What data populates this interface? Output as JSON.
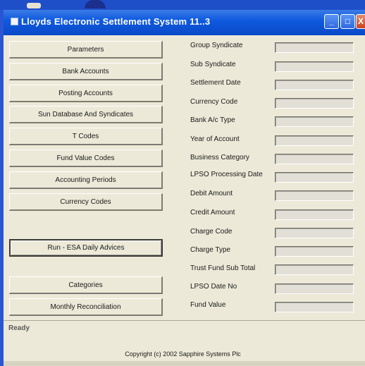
{
  "window": {
    "title": "Lloyds Electronic Settlement System 11..3",
    "controls": {
      "minimize": "_",
      "maximize": "□",
      "close": "X"
    }
  },
  "buttons": [
    "Parameters",
    "Bank Accounts",
    "Posting Accounts",
    "Sun Database And Syndicates",
    "T Codes",
    "Fund Value Codes",
    "Accounting Periods",
    "Currency Codes",
    "Run - ESA Daily Advices",
    "Categories",
    "Monthly Reconciliation"
  ],
  "fields": [
    {
      "label": "Group Syndicate",
      "value": ""
    },
    {
      "label": "Sub Syndicate",
      "value": ""
    },
    {
      "label": "Settlement Date",
      "value": ""
    },
    {
      "label": "Currency Code",
      "value": ""
    },
    {
      "label": "Bank A/c Type",
      "value": ""
    },
    {
      "label": "Year of Account",
      "value": ""
    },
    {
      "label": "Business Category",
      "value": ""
    },
    {
      "label": "LPSO Processing Date",
      "value": ""
    },
    {
      "label": "Debit Amount",
      "value": ""
    },
    {
      "label": "Credit Amount",
      "value": ""
    },
    {
      "label": "Charge Code",
      "value": ""
    },
    {
      "label": "Charge Type",
      "value": ""
    },
    {
      "label": "Trust Fund Sub Total",
      "value": ""
    },
    {
      "label": "LPSO Date No",
      "value": ""
    },
    {
      "label": "Fund Value",
      "value": ""
    }
  ],
  "status": {
    "text": "Ready"
  },
  "footer": {
    "copyright": "Copyright (c) 2002 Sapphire Systems Plc"
  },
  "colors": {
    "titlebar": "#0a49c8",
    "window_bg": "#ece9d8",
    "field_bg": "#e1dfd6"
  }
}
